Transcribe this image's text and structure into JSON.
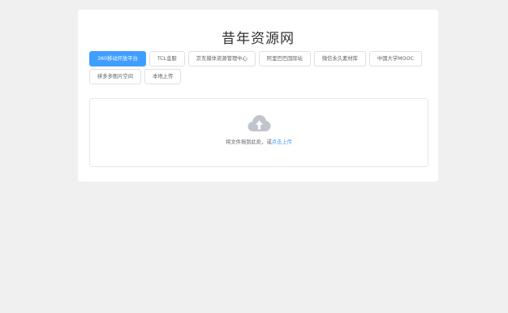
{
  "page": {
    "title": "昔年资源网"
  },
  "tabs": [
    {
      "label": "360移动开放平台",
      "active": true
    },
    {
      "label": "TCL金服",
      "active": false
    },
    {
      "label": "京东媒体资源管理中心",
      "active": false
    },
    {
      "label": "阿里巴巴国际站",
      "active": false
    },
    {
      "label": "微信永久素材库",
      "active": false
    },
    {
      "label": "中国大学MOOC",
      "active": false
    },
    {
      "label": "拼多多图片空间",
      "active": false
    },
    {
      "label": "本地上传",
      "active": false
    }
  ],
  "upload": {
    "icon": "cloud-upload-icon",
    "hint_text": "将文件拖到此处，或",
    "hint_link": "点击上传"
  },
  "colors": {
    "accent": "#409eff",
    "background": "#f0f0f0",
    "card": "#ffffff",
    "icon": "#c0c4cc"
  }
}
